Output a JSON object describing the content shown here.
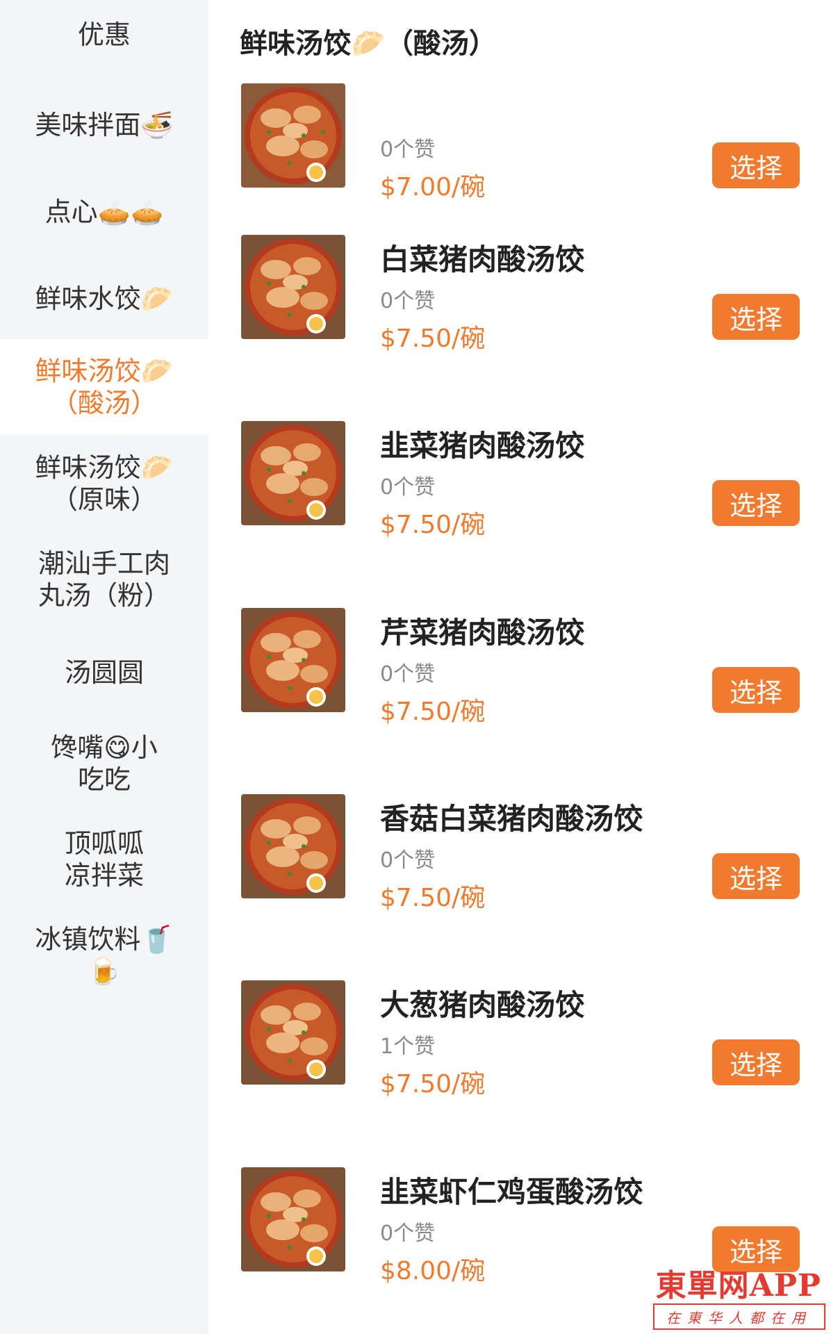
{
  "sidebar": {
    "categories": [
      {
        "label": "优惠"
      },
      {
        "label": "美味拌面🍜"
      },
      {
        "label": "点心🥧🥧"
      },
      {
        "label": "鲜味水饺🥟"
      },
      {
        "label": "鲜味汤饺🥟\n（酸汤）"
      },
      {
        "label": "鲜味汤饺🥟\n（原味）"
      },
      {
        "label": "潮汕手工肉\n丸汤（粉）"
      },
      {
        "label": "汤圆圆"
      },
      {
        "label": "馋嘴😋小\n吃吃"
      },
      {
        "label": "顶呱呱\n凉拌菜"
      },
      {
        "label": "冰镇饮料🥤\n🍺"
      }
    ]
  },
  "main": {
    "section_title": "鲜味汤饺🥟（酸汤）",
    "items": [
      {
        "name": "",
        "likes": "0个赞",
        "price": "$7.00/碗",
        "button": "选择"
      },
      {
        "name": "白菜猪肉酸汤饺",
        "likes": "0个赞",
        "price": "$7.50/碗",
        "button": "选择"
      },
      {
        "name": "韭菜猪肉酸汤饺",
        "likes": "0个赞",
        "price": "$7.50/碗",
        "button": "选择"
      },
      {
        "name": "芹菜猪肉酸汤饺",
        "likes": "0个赞",
        "price": "$7.50/碗",
        "button": "选择"
      },
      {
        "name": "香菇白菜猪肉酸汤饺",
        "likes": "0个赞",
        "price": "$7.50/碗",
        "button": "选择"
      },
      {
        "name": "大葱猪肉酸汤饺",
        "likes": "1个赞",
        "price": "$7.50/碗",
        "button": "选择"
      },
      {
        "name": "韭菜虾仁鸡蛋酸汤饺",
        "likes": "0个赞",
        "price": "$8.00/碗",
        "button": "选择"
      }
    ]
  },
  "watermark": {
    "brand": "東單网APP",
    "slogan": "在東华人都在用"
  },
  "colors": {
    "accent": "#f07a2e",
    "sidebar_bg": "#f4f5f7"
  }
}
